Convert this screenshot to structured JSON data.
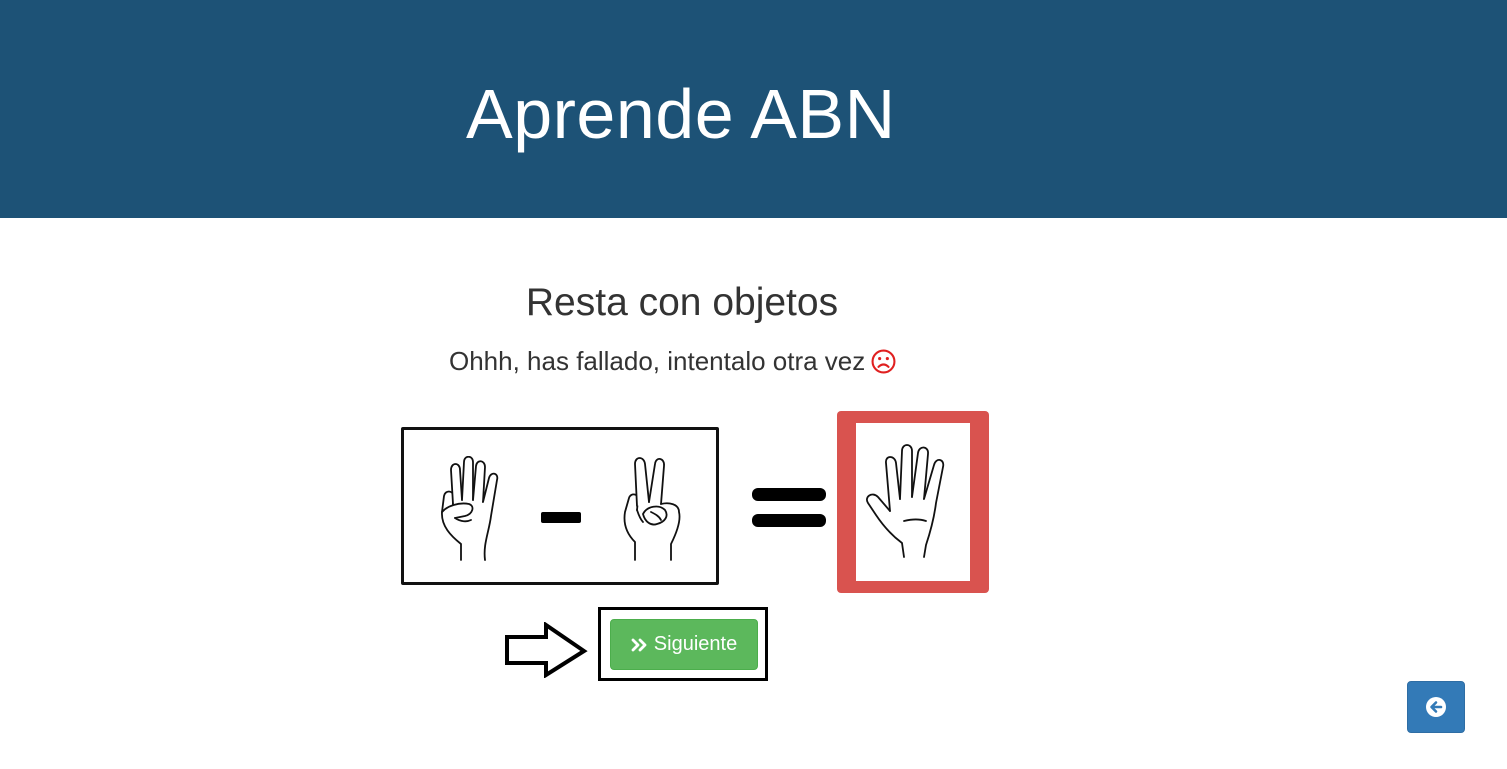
{
  "header": {
    "title": "Aprende ABN"
  },
  "exercise": {
    "title": "Resta con objetos",
    "feedback": "Ohhh, has fallado, intentalo otra vez",
    "operation": {
      "left_operand_fingers": 4,
      "operator": "-",
      "right_operand_fingers": 2,
      "equals": "=",
      "selected_answer_fingers": 5,
      "answer_status": "incorrect"
    }
  },
  "buttons": {
    "next_label": "Siguiente",
    "next_icon": "double-chevron-right-icon",
    "back_icon": "arrow-circle-left-icon"
  },
  "colors": {
    "header_bg": "#1d5276",
    "wrong_answer": "#d9534f",
    "next_button": "#5cb85c",
    "back_button": "#337ab7",
    "sad_face": "#e02020"
  }
}
